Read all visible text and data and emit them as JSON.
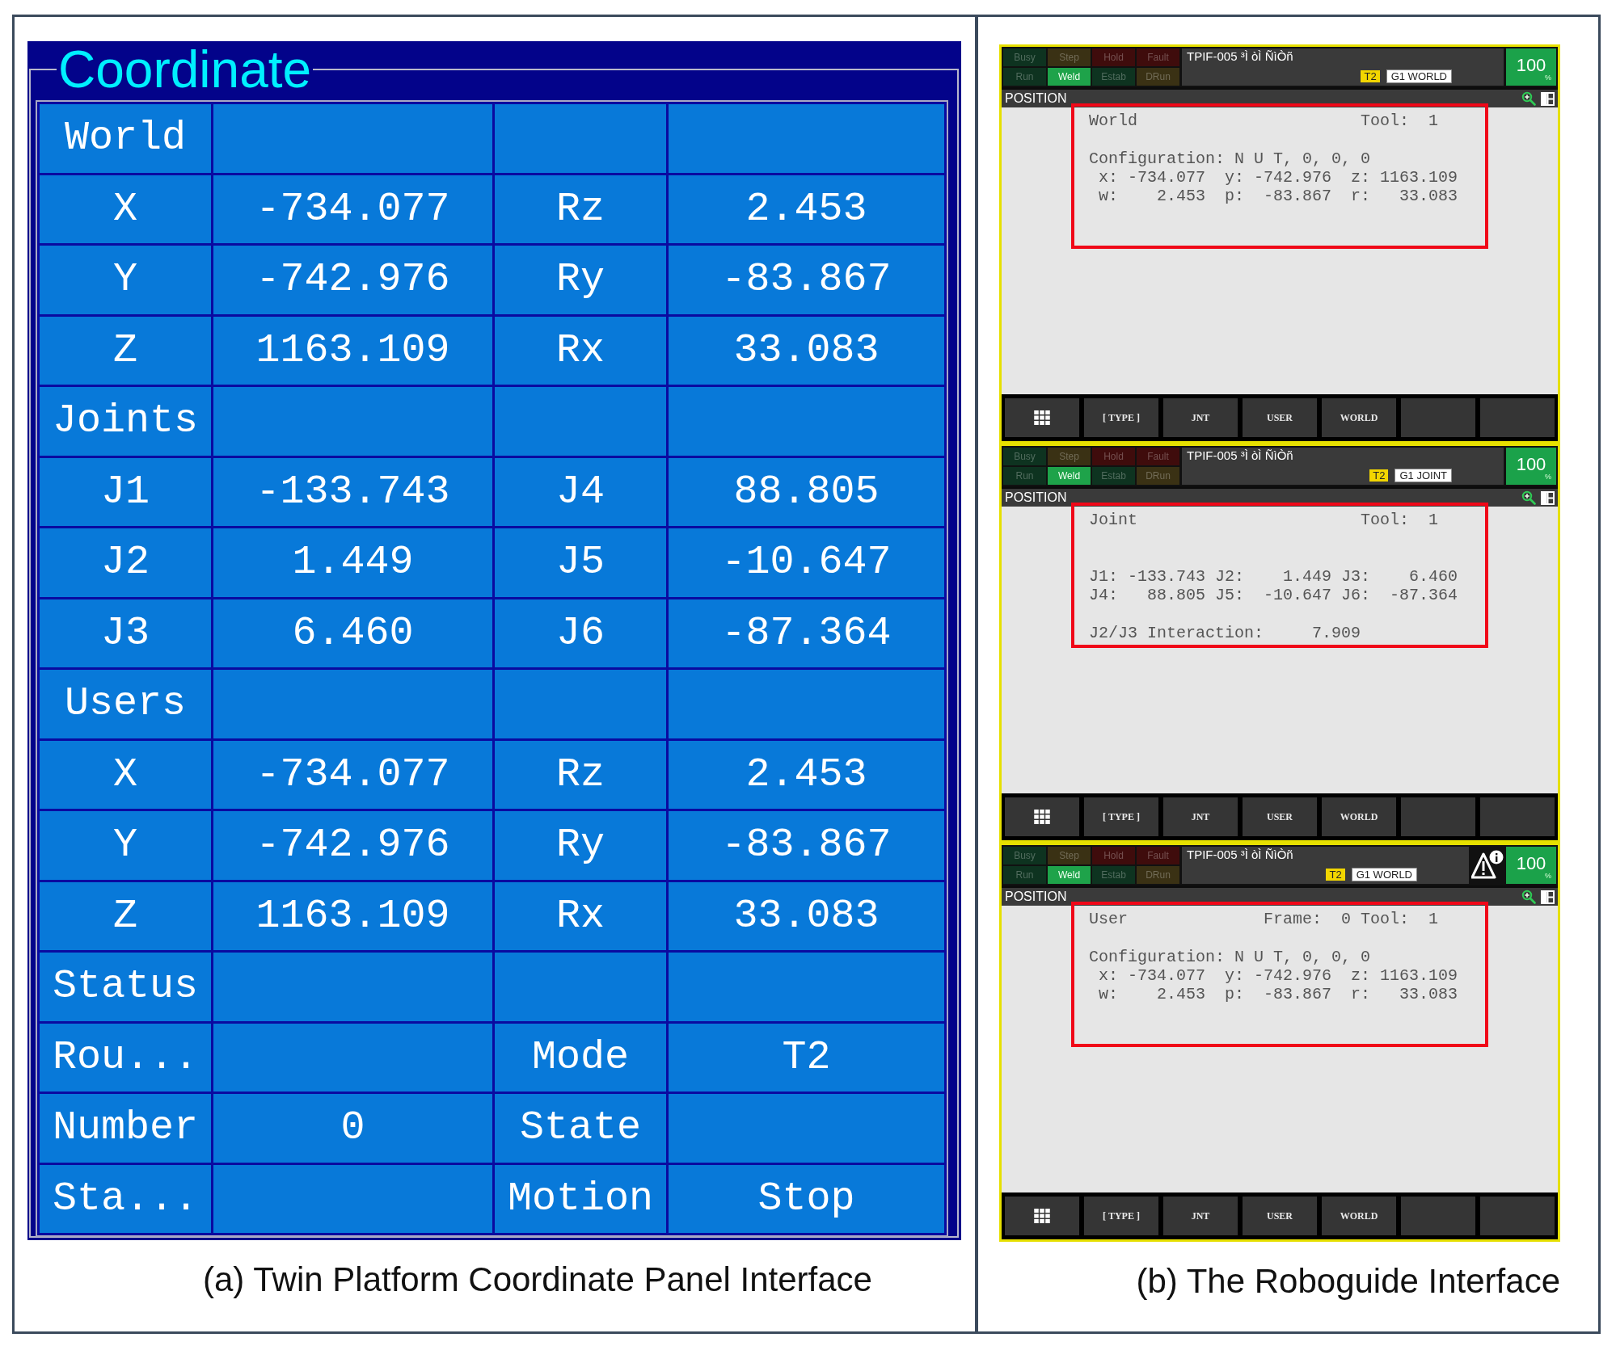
{
  "coordinate_panel": {
    "title": "Coordinate",
    "rows": [
      {
        "label": "World"
      },
      {
        "label": "X",
        "value": "-734.077",
        "label_2": "Rz",
        "value_2": "2.453"
      },
      {
        "label": "Y",
        "value": "-742.976",
        "label_2": "Ry",
        "value_2": "-83.867"
      },
      {
        "label": "Z",
        "value": "1163.109",
        "label_2": "Rx",
        "value_2": "33.083"
      },
      {
        "label": "Joints"
      },
      {
        "label": "J1",
        "value": "-133.743",
        "label_2": "J4",
        "value_2": "88.805"
      },
      {
        "label": "J2",
        "value": "1.449",
        "label_2": "J5",
        "value_2": "-10.647"
      },
      {
        "label": "J3",
        "value": "6.460",
        "label_2": "J6",
        "value_2": "-87.364"
      },
      {
        "label": "Users"
      },
      {
        "label": "X",
        "value": "-734.077",
        "label_2": "Rz",
        "value_2": "2.453"
      },
      {
        "label": "Y",
        "value": "-742.976",
        "label_2": "Ry",
        "value_2": "-83.867"
      },
      {
        "label": "Z",
        "value": "1163.109",
        "label_2": "Rx",
        "value_2": "33.083"
      },
      {
        "label": "Status"
      },
      {
        "label": "Rou...",
        "label_2": "Mode",
        "value_2": "T2"
      },
      {
        "label": "Number",
        "value": "0",
        "label_2": "State"
      },
      {
        "label": "Sta...",
        "label_2": "Motion",
        "value_2": "Stop"
      }
    ],
    "caption": "(a) Twin Platform Coordinate Panel Interface"
  },
  "roboguide": {
    "screens": [
      {
        "status_lamps": [
          {
            "label": "Busy",
            "on": false,
            "color": "#0e3320"
          },
          {
            "label": "Step",
            "on": false,
            "color": "#3a3114"
          },
          {
            "label": "Hold",
            "on": false,
            "color": "#3f0c0c"
          },
          {
            "label": "Fault",
            "on": false,
            "color": "#3f0c0c"
          },
          {
            "label": "Run",
            "on": false,
            "color": "#0e3320"
          },
          {
            "label": "Weld",
            "on": true,
            "color": "#1ea34a"
          },
          {
            "label": "Estab",
            "on": false,
            "color": "#0e3320"
          },
          {
            "label": "DRun",
            "on": false,
            "color": "#3a3114"
          }
        ],
        "program": "TPIF-005 ³Ì òÌ ÑìÒñ",
        "mode": "T2",
        "coordinate_system": "G1 WORLD",
        "warning": false,
        "override": "100",
        "override_unit": "%",
        "menu": "POSITION",
        "heading": "World",
        "frame_tool": "Tool:  1",
        "lines": [
          {
            "kind": "blank"
          },
          {
            "kind": "text",
            "text": "Configuration: N U T, 0, 0, 0"
          },
          {
            "kind": "text",
            "text": " x: -734.077  y: -742.976  z: 1163.109"
          },
          {
            "kind": "text",
            "text": " w:    2.453  p:  -83.867  r:   33.083"
          }
        ],
        "function_keys": [
          {
            "kind": "icon"
          },
          {
            "kind": "label",
            "label": "[ TYPE ]"
          },
          {
            "kind": "label",
            "label": "JNT"
          },
          {
            "kind": "label",
            "label": "USER"
          },
          {
            "kind": "label",
            "label": "WORLD"
          },
          {
            "kind": "blank"
          },
          {
            "kind": "blank"
          }
        ]
      },
      {
        "status_lamps": [
          {
            "label": "Busy",
            "on": false,
            "color": "#0e3320"
          },
          {
            "label": "Step",
            "on": false,
            "color": "#3a3114"
          },
          {
            "label": "Hold",
            "on": false,
            "color": "#3f0c0c"
          },
          {
            "label": "Fault",
            "on": false,
            "color": "#3f0c0c"
          },
          {
            "label": "Run",
            "on": false,
            "color": "#0e3320"
          },
          {
            "label": "Weld",
            "on": true,
            "color": "#1ea34a"
          },
          {
            "label": "Estab",
            "on": false,
            "color": "#0e3320"
          },
          {
            "label": "DRun",
            "on": false,
            "color": "#3a3114"
          }
        ],
        "program": "TPIF-005 ³Ì òÌ ÑìÒñ",
        "mode": "T2",
        "coordinate_system": "G1 JOINT",
        "warning": false,
        "override": "100",
        "override_unit": "%",
        "menu": "POSITION",
        "heading": "Joint",
        "frame_tool": "Tool:  1",
        "lines": [
          {
            "kind": "blank"
          },
          {
            "kind": "blank"
          },
          {
            "kind": "text",
            "text": "J1: -133.743 J2:    1.449 J3:    6.460"
          },
          {
            "kind": "text",
            "text": "J4:   88.805 J5:  -10.647 J6:  -87.364"
          },
          {
            "kind": "blank"
          },
          {
            "kind": "text",
            "text": "J2/J3 Interaction:     7.909"
          }
        ],
        "function_keys": [
          {
            "kind": "icon"
          },
          {
            "kind": "label",
            "label": "[ TYPE ]"
          },
          {
            "kind": "label",
            "label": "JNT"
          },
          {
            "kind": "label",
            "label": "USER"
          },
          {
            "kind": "label",
            "label": "WORLD"
          },
          {
            "kind": "blank"
          },
          {
            "kind": "blank"
          }
        ]
      },
      {
        "status_lamps": [
          {
            "label": "Busy",
            "on": false,
            "color": "#0e3320"
          },
          {
            "label": "Step",
            "on": false,
            "color": "#3a3114"
          },
          {
            "label": "Hold",
            "on": false,
            "color": "#3f0c0c"
          },
          {
            "label": "Fault",
            "on": false,
            "color": "#3f0c0c"
          },
          {
            "label": "Run",
            "on": false,
            "color": "#0e3320"
          },
          {
            "label": "Weld",
            "on": true,
            "color": "#1ea34a"
          },
          {
            "label": "Estab",
            "on": false,
            "color": "#0e3320"
          },
          {
            "label": "DRun",
            "on": false,
            "color": "#3a3114"
          }
        ],
        "program": "TPIF-005 ³Ì òÌ ÑìÒñ",
        "mode": "T2",
        "coordinate_system": "G1 WORLD",
        "warning": true,
        "override": "100",
        "override_unit": "%",
        "menu": "POSITION",
        "heading": "User",
        "frame_tool": "Frame:  0 Tool:  1",
        "lines": [
          {
            "kind": "blank"
          },
          {
            "kind": "text",
            "text": "Configuration: N U T, 0, 0, 0"
          },
          {
            "kind": "text",
            "text": " x: -734.077  y: -742.976  z: 1163.109"
          },
          {
            "kind": "text",
            "text": " w:    2.453  p:  -83.867  r:   33.083"
          }
        ],
        "function_keys": [
          {
            "kind": "icon"
          },
          {
            "kind": "label",
            "label": "[ TYPE ]"
          },
          {
            "kind": "label",
            "label": "JNT"
          },
          {
            "kind": "label",
            "label": "USER"
          },
          {
            "kind": "label",
            "label": "WORLD"
          },
          {
            "kind": "blank"
          },
          {
            "kind": "blank"
          }
        ]
      }
    ],
    "caption": "(b) The Roboguide Interface"
  }
}
